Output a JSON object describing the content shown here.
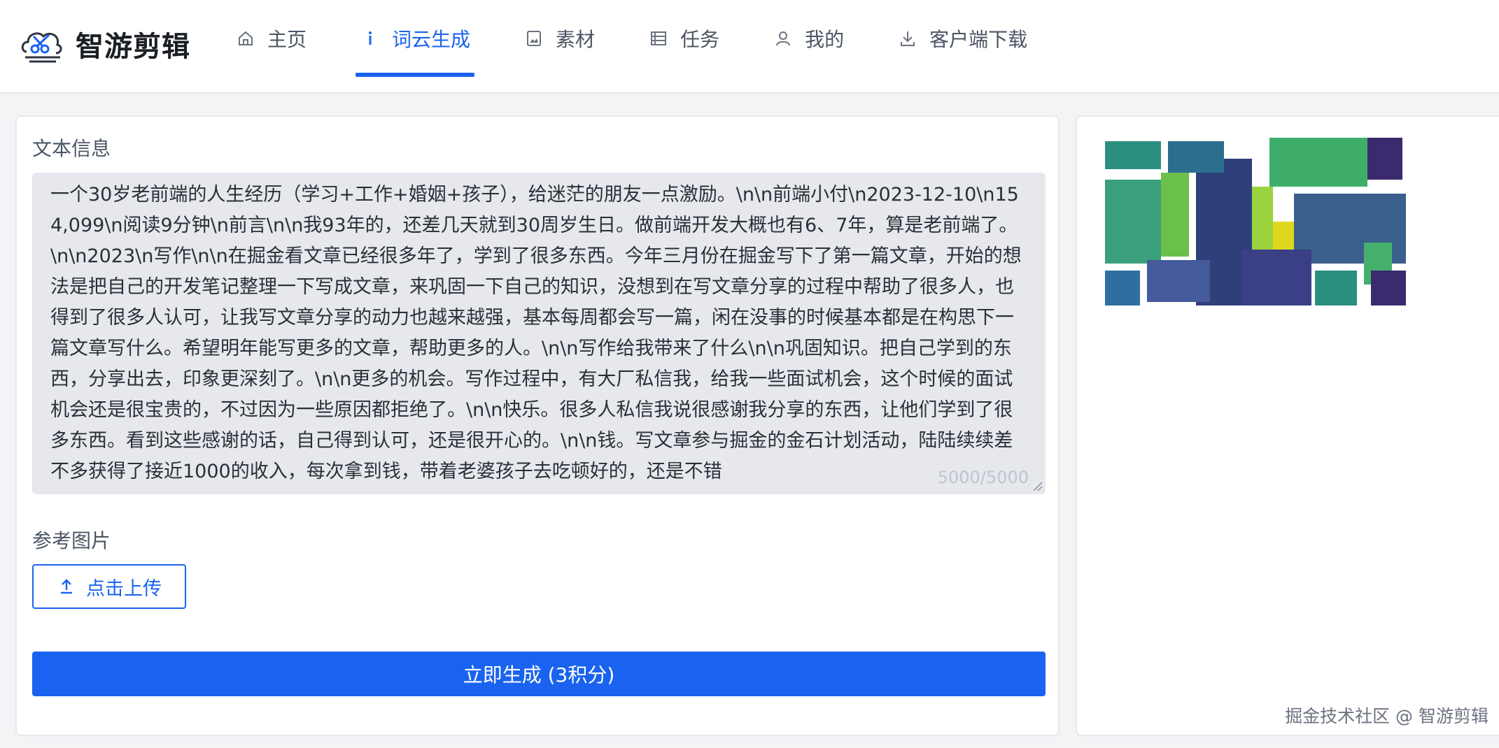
{
  "brand": {
    "name": "智游剪辑",
    "icon": "scissors-cloud-logo"
  },
  "nav": {
    "items": [
      {
        "label": "主页",
        "icon": "home-icon",
        "active": false
      },
      {
        "label": "词云生成",
        "icon": "info-icon",
        "active": true
      },
      {
        "label": "素材",
        "icon": "image-icon",
        "active": false
      },
      {
        "label": "任务",
        "icon": "list-icon",
        "active": false
      },
      {
        "label": "我的",
        "icon": "user-icon",
        "active": false
      },
      {
        "label": "客户端下载",
        "icon": "download-icon",
        "active": false
      }
    ]
  },
  "form": {
    "text_label": "文本信息",
    "text_value": "一个30岁老前端的人生经历（学习+工作+婚姻+孩子），给迷茫的朋友一点激励。\\n\\n前端小付\\n2023-12-10\\n154,099\\n阅读9分钟\\n前言\\n\\n我93年的，还差几天就到30周岁生日。做前端开发大概也有6、7年，算是老前端了。\\n\\n2023\\n写作\\n\\n在掘金看文章已经很多年了，学到了很多东西。今年三月份在掘金写下了第一篇文章，开始的想法是把自己的开发笔记整理一下写成文章，来巩固一下自己的知识，没想到在写文章分享的过程中帮助了很多人，也得到了很多人认可，让我写文章分享的动力也越来越强，基本每周都会写一篇，闲在没事的时候基本都是在构思下一篇文章写什么。希望明年能写更多的文章，帮助更多的人。\\n\\n写作给我带来了什么\\n\\n巩固知识。把自己学到的东西，分享出去，印象更深刻了。\\n\\n更多的机会。写作过程中，有大厂私信我，给我一些面试机会，这个时候的面试机会还是很宝贵的，不过因为一些原因都拒绝了。\\n\\n快乐。很多人私信我说很感谢我分享的东西，让他们学到了很多东西。看到这些感谢的话，自己得到认可，还是很开心的。\\n\\n钱。写文章参与掘金的金石计划活动，陆陆续续差不多获得了接近1000的收入，每次拿到钱，带着老婆孩子去吃顿好的，还是不错",
    "counter": "5000/5000",
    "image_label": "参考图片",
    "upload_label": "点击上传",
    "generate_label": "立即生成 (3积分)"
  },
  "watermark": "掘金技术社区 @ 智游剪辑",
  "colors": {
    "primary": "#1a63f0",
    "wordcloud_palette": [
      "#3b2a6e",
      "#2c6e8e",
      "#2b8f7f",
      "#45b06b",
      "#9bd33f",
      "#e0d81f",
      "#414487"
    ]
  }
}
